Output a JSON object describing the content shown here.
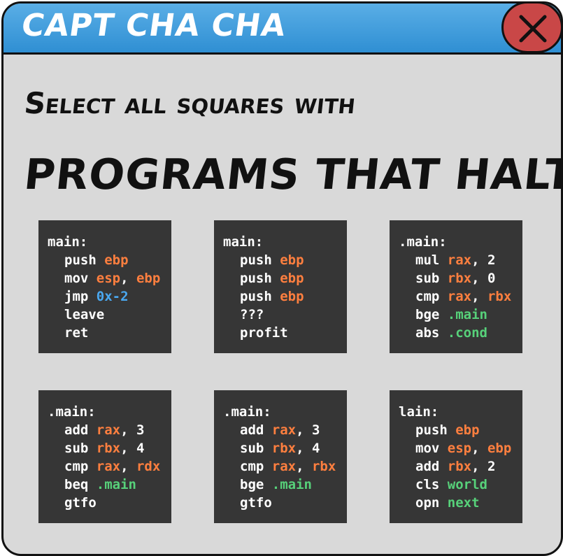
{
  "window": {
    "title": "CAPT CHA CHA"
  },
  "prompt": {
    "line1": "Select all squares with",
    "line2": "PROGRAMS THAT HALT"
  },
  "colors": {
    "register": "#ff7f3f",
    "hex": "#4aa8f0",
    "label": "#57d17a",
    "tile_bg": "#363636",
    "titlebar": "#3b9ad9",
    "close_button": "#c94747",
    "window_bg": "#d9d9d9"
  },
  "icons": {
    "close": "close-icon"
  },
  "tiles": [
    {
      "label": "main:",
      "lines": [
        [
          {
            "t": "push "
          },
          {
            "t": "ebp",
            "c": "reg"
          }
        ],
        [
          {
            "t": "mov "
          },
          {
            "t": "esp",
            "c": "reg"
          },
          {
            "t": ", "
          },
          {
            "t": "ebp",
            "c": "reg"
          }
        ],
        [
          {
            "t": "jmp "
          },
          {
            "t": "0x-2",
            "c": "hex"
          }
        ],
        [
          {
            "t": "leave"
          }
        ],
        [
          {
            "t": "ret"
          }
        ]
      ]
    },
    {
      "label": "main:",
      "lines": [
        [
          {
            "t": "push "
          },
          {
            "t": "ebp",
            "c": "reg"
          }
        ],
        [
          {
            "t": "push "
          },
          {
            "t": "ebp",
            "c": "reg"
          }
        ],
        [
          {
            "t": "push "
          },
          {
            "t": "ebp",
            "c": "reg"
          }
        ],
        [
          {
            "t": "???"
          }
        ],
        [
          {
            "t": "profit"
          }
        ]
      ]
    },
    {
      "label": ".main:",
      "lines": [
        [
          {
            "t": "mul "
          },
          {
            "t": "rax",
            "c": "reg"
          },
          {
            "t": ", 2"
          }
        ],
        [
          {
            "t": "sub "
          },
          {
            "t": "rbx",
            "c": "reg"
          },
          {
            "t": ", 0"
          }
        ],
        [
          {
            "t": "cmp "
          },
          {
            "t": "rax",
            "c": "reg"
          },
          {
            "t": ", "
          },
          {
            "t": "rbx",
            "c": "reg"
          }
        ],
        [
          {
            "t": "bge "
          },
          {
            "t": ".main",
            "c": "lbl"
          }
        ],
        [
          {
            "t": "abs "
          },
          {
            "t": ".cond",
            "c": "lbl"
          }
        ]
      ]
    },
    {
      "label": ".main:",
      "lines": [
        [
          {
            "t": "add "
          },
          {
            "t": "rax",
            "c": "reg"
          },
          {
            "t": ", 3"
          }
        ],
        [
          {
            "t": "sub "
          },
          {
            "t": "rbx",
            "c": "reg"
          },
          {
            "t": ", 4"
          }
        ],
        [
          {
            "t": "cmp "
          },
          {
            "t": "rax",
            "c": "reg"
          },
          {
            "t": ", "
          },
          {
            "t": "rdx",
            "c": "reg"
          }
        ],
        [
          {
            "t": "beq "
          },
          {
            "t": ".main",
            "c": "lbl"
          }
        ],
        [
          {
            "t": "gtfo"
          }
        ]
      ]
    },
    {
      "label": ".main:",
      "lines": [
        [
          {
            "t": "add "
          },
          {
            "t": "rax",
            "c": "reg"
          },
          {
            "t": ", 3"
          }
        ],
        [
          {
            "t": "sub "
          },
          {
            "t": "rbx",
            "c": "reg"
          },
          {
            "t": ", 4"
          }
        ],
        [
          {
            "t": "cmp "
          },
          {
            "t": "rax",
            "c": "reg"
          },
          {
            "t": ", "
          },
          {
            "t": "rbx",
            "c": "reg"
          }
        ],
        [
          {
            "t": "bge "
          },
          {
            "t": ".main",
            "c": "lbl"
          }
        ],
        [
          {
            "t": "gtfo"
          }
        ]
      ]
    },
    {
      "label": "lain:",
      "lines": [
        [
          {
            "t": "push "
          },
          {
            "t": "ebp",
            "c": "reg"
          }
        ],
        [
          {
            "t": "mov "
          },
          {
            "t": "esp",
            "c": "reg"
          },
          {
            "t": ", "
          },
          {
            "t": "ebp",
            "c": "reg"
          }
        ],
        [
          {
            "t": "add "
          },
          {
            "t": "rbx",
            "c": "reg"
          },
          {
            "t": ", 2"
          }
        ],
        [
          {
            "t": "cls "
          },
          {
            "t": "world",
            "c": "lbl"
          }
        ],
        [
          {
            "t": "opn "
          },
          {
            "t": "next",
            "c": "lbl"
          }
        ]
      ]
    }
  ]
}
